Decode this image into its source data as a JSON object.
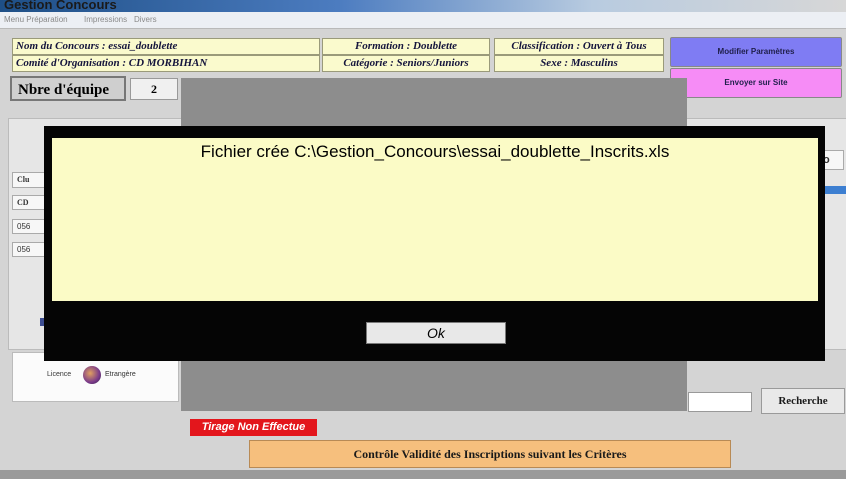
{
  "window": {
    "title": "Gestion Concours"
  },
  "menu": [
    "Menu Préparation",
    "Impressions",
    "Divers"
  ],
  "header": {
    "nom_concours": "Nom du Concours : essai_doublette",
    "comite": "Comité d'Organisation : CD MORBIHAN",
    "formation": "Formation : Doublette",
    "categorie": "Catégorie : Seniors/Juniors",
    "classification": "Classification : Ouvert à Tous",
    "sexe": "Sexe : Masculins",
    "modifier_btn": "Modifier Paramètres",
    "envoyer_btn": "Envoyer sur Site",
    "nbre_label": "Nbre d'équipe",
    "nbre_value": "2"
  },
  "form": {
    "tab_label": "Clu",
    "col_cd": "CD",
    "rows": [
      "056",
      "056"
    ],
    "licence_label": "Licence",
    "etrangere_label": "Etrangère",
    "partial_button": "o",
    "search_placeholder": "",
    "recherche": "Recherche"
  },
  "dialog": {
    "message": "Fichier crée C:\\Gestion_Concours\\essai_doublette_Inscrits.xls",
    "ok": "Ok"
  },
  "status": {
    "tirage": "Tirage Non Effectue",
    "controle": "Contrôle Validité des Inscriptions suivant les Critères"
  },
  "colors": {
    "info_bg": "#fafacd",
    "modifier_bg": "#7f7cf3",
    "envoyer_bg": "#f68cf6",
    "tirage_bg": "#e3161c",
    "controle_bg": "#f6bf7d",
    "dialog_msg_bg": "#fbfbc6"
  }
}
